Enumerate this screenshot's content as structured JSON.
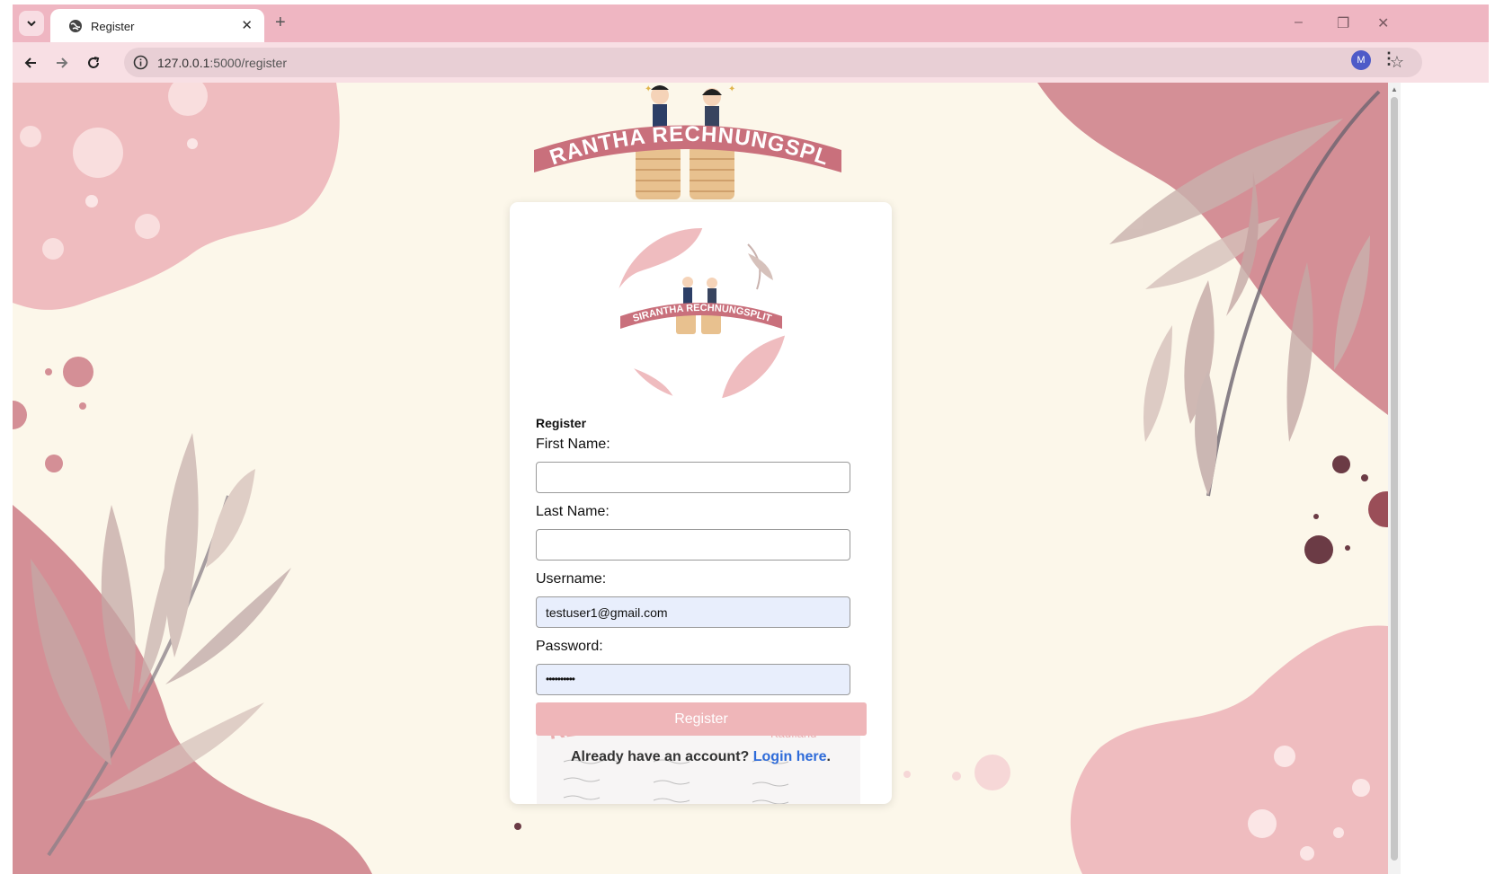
{
  "browser": {
    "tab_title": "Register",
    "tab_close": "✕",
    "new_tab": "+",
    "url_host": "127.0.0.1",
    "url_path": ":5000/register",
    "profile_initial": "M",
    "window_minimize": "–",
    "window_restore": "❐",
    "window_close": "✕",
    "menu": "⋮"
  },
  "page": {
    "banner_text": "SIRANTHA RECHNUNGSPLIT",
    "form_title": "Register",
    "first_name_label": "First Name:",
    "first_name_value": "",
    "last_name_label": "Last Name:",
    "last_name_value": "",
    "username_label": "Username:",
    "username_value": "testuser1@gmail.com",
    "password_label": "Password:",
    "password_mask": "••••••••••",
    "submit_label": "Register",
    "login_prompt": "Already have an account?",
    "login_link": "Login here",
    "login_suffix": ".",
    "receipt_brands": [
      "REWE",
      "dm",
      "Kaufland"
    ]
  },
  "colors": {
    "tab_strip": "#efb6c2",
    "page_background": "#fcf7ea",
    "accent_pink": "#d48f96",
    "light_pink": "#efbcbf",
    "button": "#efb6b9",
    "link": "#2e6bd9",
    "autofill": "#e8eefc"
  }
}
